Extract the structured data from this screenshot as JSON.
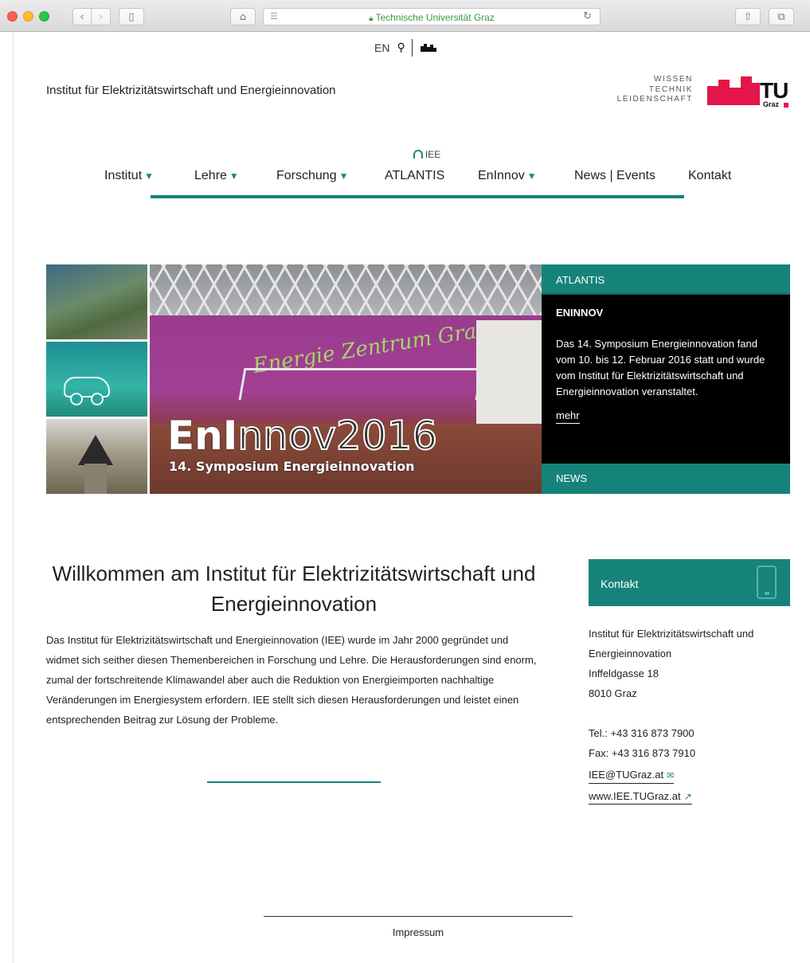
{
  "browser": {
    "url_text": "Technische Universität Graz",
    "lock_icon": "lock-icon"
  },
  "util": {
    "lang": "EN",
    "search_icon": "search-icon"
  },
  "header": {
    "institute_name": "Institut für Elektrizitätswirtschaft und Energieinnovation",
    "slogan": [
      "WISSEN",
      "TECHNIK",
      "LEIDENSCHAFT"
    ],
    "logo_text": "TU",
    "logo_sub": "Graz"
  },
  "nav": {
    "home_label": "IEE",
    "items": [
      {
        "label": "Institut",
        "dropdown": true
      },
      {
        "label": "Lehre",
        "dropdown": true
      },
      {
        "label": "Forschung",
        "dropdown": true
      },
      {
        "label": "ATLANTIS",
        "dropdown": false
      },
      {
        "label": "EnInnov",
        "dropdown": true
      },
      {
        "label": "News | Events",
        "dropdown": false
      },
      {
        "label": "Kontakt",
        "dropdown": false
      }
    ],
    "arrow": "▼"
  },
  "hero": {
    "banner_title_solid": "EnI",
    "banner_title_outline": "nnov2016",
    "banner_subtitle": "14. Symposium Energieinnovation",
    "side_top": "ATLANTIS",
    "side_heading": "ENINNOV",
    "side_text": "Das 14. Symposium Energieinnovation fand vom 10. bis 12. Februar 2016 statt und wurde vom Institut für Elektrizitätswirtschaft und Energieinnovation veranstaltet.",
    "side_more": "mehr",
    "side_bottom": "NEWS"
  },
  "welcome": {
    "title": "Willkommen am Institut für Elektrizitätswirtschaft und Energieinnovation",
    "text": "Das Institut für Elektrizitätswirtschaft und Energieinnovation (IEE) wurde im Jahr 2000 gegründet und widmet sich seither diesen Themenbereichen in Forschung und Lehre. Die Herausforderungen sind enorm, zumal der fortschreitende Klimawandel aber auch die Reduktion von Energieimporten nachhaltige Veränderungen im Energiesystem erfordern. IEE stellt sich diesen Herausforderungen und leistet einen entsprechenden Beitrag zur Lösung der Probleme."
  },
  "contact": {
    "box_label": "Kontakt",
    "address": [
      "Institut für Elektrizitätswirtschaft und Energieinnovation",
      "Inffeldgasse 18",
      "8010 Graz"
    ],
    "tel": "Tel.: +43 316 873 7900",
    "fax": "Fax: +43 316 873 7910",
    "email": "IEE@TUGraz.at",
    "web": "www.IEE.TUGraz.at"
  },
  "footer": {
    "impressum": "Impressum"
  },
  "colors": {
    "accent": "#16837a",
    "tu_red": "#e4154b"
  }
}
